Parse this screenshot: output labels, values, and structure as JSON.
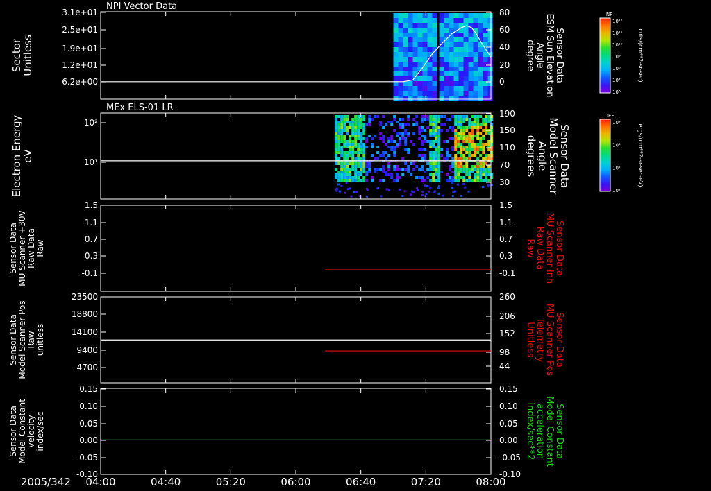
{
  "colors": {
    "background": "#000000",
    "axis": "#ffffff",
    "red_series": "#e01010",
    "green_series": "#20d020",
    "white_series": "#ffffff"
  },
  "time_axis": {
    "date_label": "2005/342",
    "ticks": [
      "04:00",
      "04:40",
      "05:20",
      "06:00",
      "06:40",
      "07:20",
      "08:00"
    ],
    "tick_hours": [
      4.0,
      4.6667,
      5.3333,
      6.0,
      6.6667,
      7.3333,
      8.0
    ],
    "range_hours": [
      4.0,
      8.0
    ]
  },
  "chart_data": [
    {
      "type": "heatmap",
      "title": "NPI Vector Data",
      "ylabel": [
        "Sector",
        "Unitless"
      ],
      "y_ticks": [
        "3.1e+01",
        "2.5e+01",
        "1.9e+01",
        "1.2e+01",
        "6.2e+00"
      ],
      "y2label": [
        "Sensor Data",
        "ESM Sun Elevation",
        "Angle",
        "degree"
      ],
      "y2_ticks": [
        "80",
        "60",
        "40",
        "20",
        "0"
      ],
      "y2lim": [
        -20,
        80
      ],
      "colorbar": {
        "label": "NF",
        "units": "cnts/(cm**2-sr-sec)",
        "ticks": [
          "10¹²",
          "10¹¹",
          "10¹⁰",
          "10⁹",
          "10⁸",
          "10⁷",
          "10⁶"
        ]
      },
      "overlay_line": {
        "name": "Sun Elevation Angle",
        "x_hours": [
          4.0,
          6.6,
          7.1,
          7.2,
          7.3,
          7.4,
          7.5,
          7.6,
          7.7,
          7.75,
          7.8,
          7.85,
          7.9,
          8.0
        ],
        "y": [
          0,
          0,
          0,
          2,
          16,
          32,
          44,
          55,
          62,
          64,
          62,
          55,
          45,
          28
        ]
      },
      "data_present_hours": [
        [
          7.0,
          7.42
        ],
        [
          7.47,
          8.0
        ]
      ]
    },
    {
      "type": "heatmap",
      "title": "MEx ELS-01 LR",
      "ylabel": [
        "Electron Energy",
        "eV"
      ],
      "y_ticks": [
        "10²",
        "10¹"
      ],
      "ylim_log": [
        1,
        2.4
      ],
      "y2label": [
        "Sensor Data",
        "Model Scanner",
        "Angle",
        "degrees"
      ],
      "y2_ticks": [
        "190",
        "150",
        "110",
        "70",
        "30"
      ],
      "y2lim": [
        10,
        190
      ],
      "colorbar": {
        "label": "DEF",
        "units": "ergs/(cm**2-sr-sec-eV)",
        "ticks": [
          "10⁴",
          "10³",
          "10²",
          "10¹"
        ]
      },
      "overlay_line": {
        "name": "Model Scanner Angle",
        "x_hours": [
          4.0,
          8.0
        ],
        "y": [
          90,
          90
        ]
      },
      "data_present_hours": [
        [
          6.4,
          8.0
        ]
      ]
    },
    {
      "type": "line",
      "ylabel": [
        "Sensor Data",
        "MU Scanner +30V",
        "Raw Data",
        "Raw"
      ],
      "y_ticks": [
        "1.5",
        "1.1",
        "0.7",
        "0.3",
        "-0.1"
      ],
      "ylim": [
        -0.5,
        1.5
      ],
      "y2label": [
        "Sensor Data",
        "MU Scanner Inh",
        "Raw Data",
        "Raw"
      ],
      "y2_ticks": [
        "1.5",
        "1.1",
        "0.7",
        "0.3",
        "-0.1"
      ],
      "y2lim": [
        -0.5,
        1.5
      ],
      "series": [
        {
          "axis": "right",
          "color": "#e01010",
          "x_hours": [
            6.3,
            8.0
          ],
          "y": [
            0.0,
            0.0
          ]
        }
      ]
    },
    {
      "type": "line",
      "ylabel": [
        "Sensor Data",
        "Model Scanner Pos",
        "Raw",
        "unitless"
      ],
      "y_ticks": [
        "23500",
        "18800",
        "14100",
        "9400",
        "4700"
      ],
      "ylim": [
        0,
        23500
      ],
      "y2label": [
        "Sensor Data",
        "MU Scanner Pos",
        "Telemetry",
        "Unitless"
      ],
      "y2_ticks": [
        "260",
        "206",
        "152",
        "98",
        "44"
      ],
      "y2lim": [
        -10,
        260
      ],
      "series": [
        {
          "axis": "left",
          "color": "#ffffff",
          "x_hours": [
            4.0,
            8.0
          ],
          "y": [
            11700,
            11700
          ]
        },
        {
          "axis": "right",
          "color": "#e01010",
          "x_hours": [
            6.3,
            8.0
          ],
          "y": [
            90,
            90
          ]
        }
      ]
    },
    {
      "type": "line",
      "ylabel": [
        "Sensor Data",
        "Model Constant",
        "velocity",
        "index/sec"
      ],
      "y_ticks": [
        "0.15",
        "0.10",
        "0.05",
        "0.00",
        "-0.05",
        "-0.10"
      ],
      "ylim": [
        -0.1,
        0.15
      ],
      "y2label": [
        "Sensor Data",
        "Model Constant",
        "acceleration",
        "index/sec**2"
      ],
      "y2_ticks": [
        "0.15",
        "0.10",
        "0.05",
        "0.00",
        "-0.05",
        "-0.10"
      ],
      "y2lim": [
        -0.1,
        0.15
      ],
      "series": [
        {
          "axis": "right",
          "color": "#20d020",
          "x_hours": [
            4.0,
            8.0
          ],
          "y": [
            0.0,
            0.0
          ]
        }
      ]
    }
  ]
}
